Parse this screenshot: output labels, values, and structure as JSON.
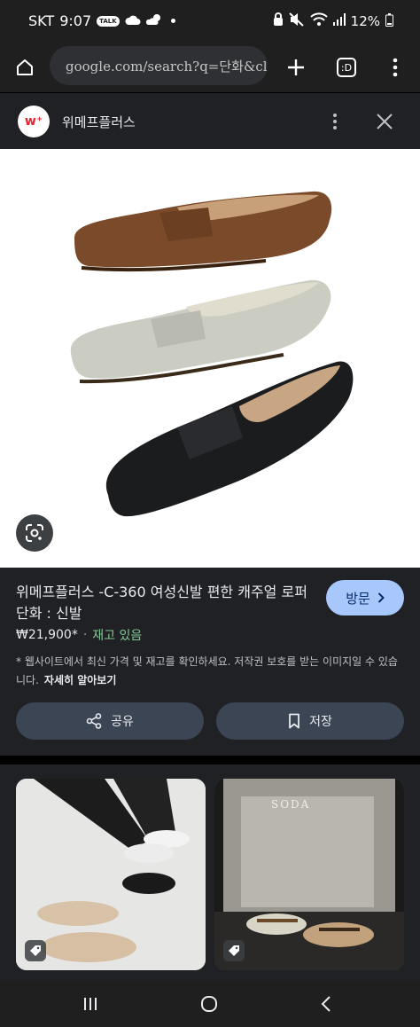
{
  "status_bar": {
    "carrier": "SKT",
    "time": "9:07",
    "talk_badge": "TALK",
    "battery": "12%"
  },
  "toolbar": {
    "url": "google.com/search?q=단화&cli",
    "tab_count": ":D"
  },
  "site": {
    "logo_text": "w⁺",
    "name": "위메프플러스"
  },
  "product": {
    "title": "위메프플러스 -C-360 여성신발 편한 캐주얼 로퍼 단화 : 신발",
    "visit_label": "방문",
    "price": "₩21,900*",
    "separator": "·",
    "stock": "재고 있음",
    "disclaimer": "* 웹사이트에서 최신 가격 및 재고를 확인하세요. 저작권 보호를 받는 이미지일 수 있습니다.",
    "learn_more": "자세히 알아보기",
    "share_label": "공유",
    "save_label": "저장"
  },
  "related": {
    "thumb2_sign": "SODA"
  },
  "colors": {
    "accent": "#a8c7fa",
    "stock_green": "#81c995",
    "button_bg": "#3c4554"
  }
}
